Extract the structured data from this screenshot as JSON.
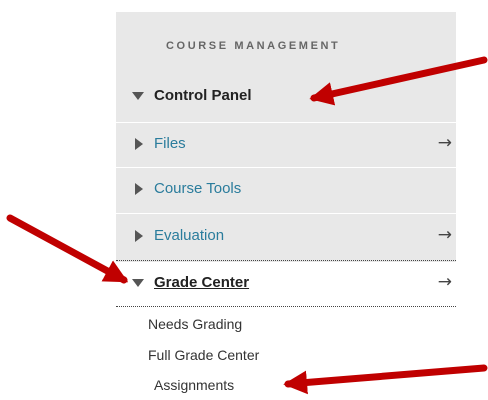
{
  "section_title": "COURSE MANAGEMENT",
  "control_panel": {
    "label": "Control Panel",
    "expanded": true
  },
  "items": [
    {
      "label": "Files",
      "has_arrow": true
    },
    {
      "label": "Course Tools",
      "has_arrow": false
    },
    {
      "label": "Evaluation",
      "has_arrow": true
    }
  ],
  "grade_center": {
    "label": "Grade Center",
    "expanded": true,
    "arrow": "→",
    "subitems": [
      "Needs Grading",
      "Full Grade Center",
      "Assignments"
    ]
  },
  "arrow_glyph": "→",
  "colors": {
    "link": "#2a7c9c",
    "annotation_arrow": "#c00000",
    "panel_bg": "#e8e8e8"
  },
  "icons": [
    "triangle-down-icon",
    "triangle-right-icon",
    "right-arrow-icon",
    "annotation-arrow-icon"
  ]
}
